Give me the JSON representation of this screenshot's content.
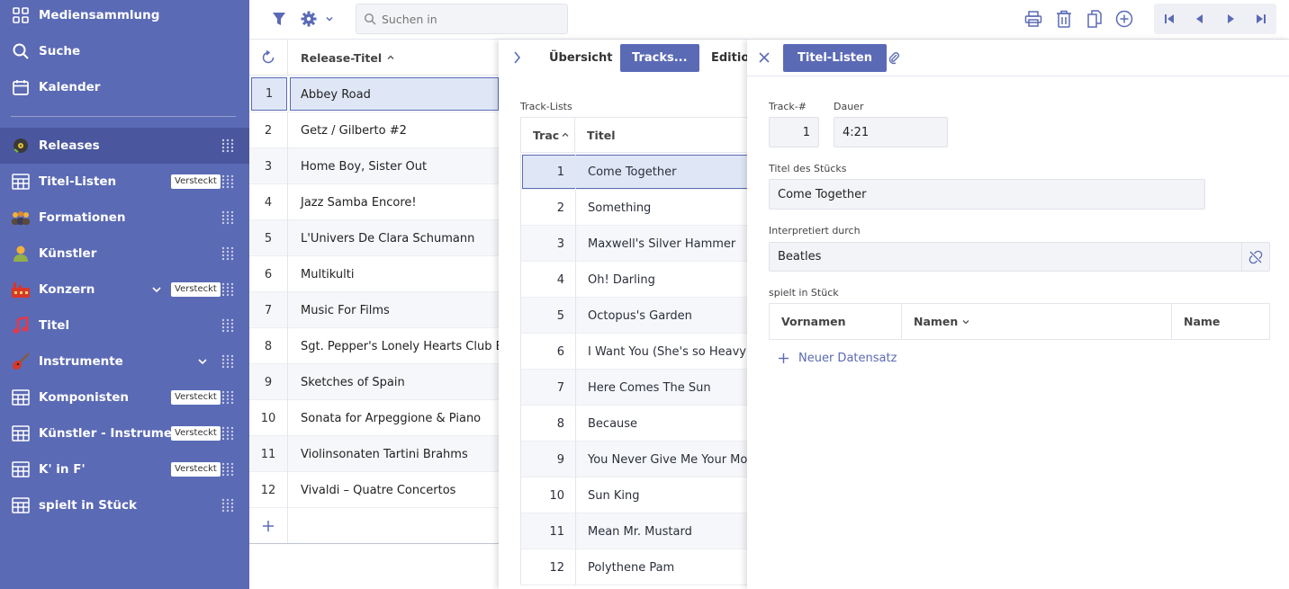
{
  "sidebar": {
    "top": [
      {
        "label": "Mediensammlung",
        "icon": "grid-icon"
      },
      {
        "label": "Suche",
        "icon": "search-icon"
      },
      {
        "label": "Kalender",
        "icon": "calendar-icon"
      }
    ],
    "items": [
      {
        "label": "Releases",
        "icon": "vinyl-record-icon",
        "active": true
      },
      {
        "label": "Titel-Listen",
        "icon": "table-icon",
        "badge": "Versteckt"
      },
      {
        "label": "Formationen",
        "icon": "band-people-icon"
      },
      {
        "label": "Künstler",
        "icon": "person-icon"
      },
      {
        "label": "Konzern",
        "icon": "factory-icon",
        "badge": "Versteckt",
        "expandable": true
      },
      {
        "label": "Titel",
        "icon": "music-note-icon"
      },
      {
        "label": "Instrumente",
        "icon": "guitar-icon",
        "expandable": true
      },
      {
        "label": "Komponisten",
        "icon": "table-icon",
        "badge": "Versteckt"
      },
      {
        "label": "Künstler - Instrument",
        "icon": "table-icon",
        "badge": "Versteckt"
      },
      {
        "label": "K' in F'",
        "icon": "table-icon",
        "badge": "Versteckt"
      },
      {
        "label": "spielt in Stück",
        "icon": "table-icon"
      }
    ]
  },
  "toolbar": {
    "search_placeholder": "Suchen in"
  },
  "main_table": {
    "column_title": "Release-Titel",
    "rows": [
      {
        "num": "1",
        "title": "Abbey Road"
      },
      {
        "num": "2",
        "title": "Getz / Gilberto #2"
      },
      {
        "num": "3",
        "title": "Home Boy, Sister Out"
      },
      {
        "num": "4",
        "title": "Jazz Samba Encore!"
      },
      {
        "num": "5",
        "title": "L'Univers De Clara Schumann"
      },
      {
        "num": "6",
        "title": "Multikulti"
      },
      {
        "num": "7",
        "title": "Music For Films"
      },
      {
        "num": "8",
        "title": "Sgt. Pepper's Lonely Hearts Club Band"
      },
      {
        "num": "9",
        "title": "Sketches of Spain"
      },
      {
        "num": "10",
        "title": "Sonata for Arpeggione & Piano"
      },
      {
        "num": "11",
        "title": "Violinsonaten Tartini Brahms"
      },
      {
        "num": "12",
        "title": "Vivaldi – Quatre Concertos"
      }
    ]
  },
  "mid_panel": {
    "tabs": [
      "Übersicht",
      "Tracks...",
      "Edition"
    ],
    "section_label": "Track-Lists",
    "col_track": "Trac",
    "col_title": "Titel",
    "tracks": [
      {
        "num": "1",
        "title": "Come Together"
      },
      {
        "num": "2",
        "title": "Something"
      },
      {
        "num": "3",
        "title": "Maxwell's Silver Hammer"
      },
      {
        "num": "4",
        "title": "Oh! Darling"
      },
      {
        "num": "5",
        "title": "Octopus's Garden"
      },
      {
        "num": "6",
        "title": "I Want You (She's so Heavy"
      },
      {
        "num": "7",
        "title": "Here Comes The Sun"
      },
      {
        "num": "8",
        "title": "Because"
      },
      {
        "num": "9",
        "title": "You Never Give Me Your Money"
      },
      {
        "num": "10",
        "title": "Sun King"
      },
      {
        "num": "11",
        "title": "Mean Mr. Mustard"
      },
      {
        "num": "12",
        "title": "Polythene Pam"
      }
    ]
  },
  "right_panel": {
    "tab_label": "Titel-Listen",
    "track_label": "Track-#",
    "track_value": "1",
    "duration_label": "Dauer",
    "duration_value": "4:21",
    "piece_title_label": "Titel des Stücks",
    "piece_title_value": "Come Together",
    "performed_label": "Interpretiert durch",
    "performed_value": "Beatles",
    "plays_in_label": "spielt in Stück",
    "columns": [
      "Vornamen",
      "Namen",
      "Name"
    ],
    "new_record": "Neuer Datensatz"
  },
  "colors": {
    "sidebar": "#5b6ab5",
    "sidebar_active": "#4a579e",
    "accent": "#5b6ab5",
    "selection": "#dfe7f7"
  }
}
